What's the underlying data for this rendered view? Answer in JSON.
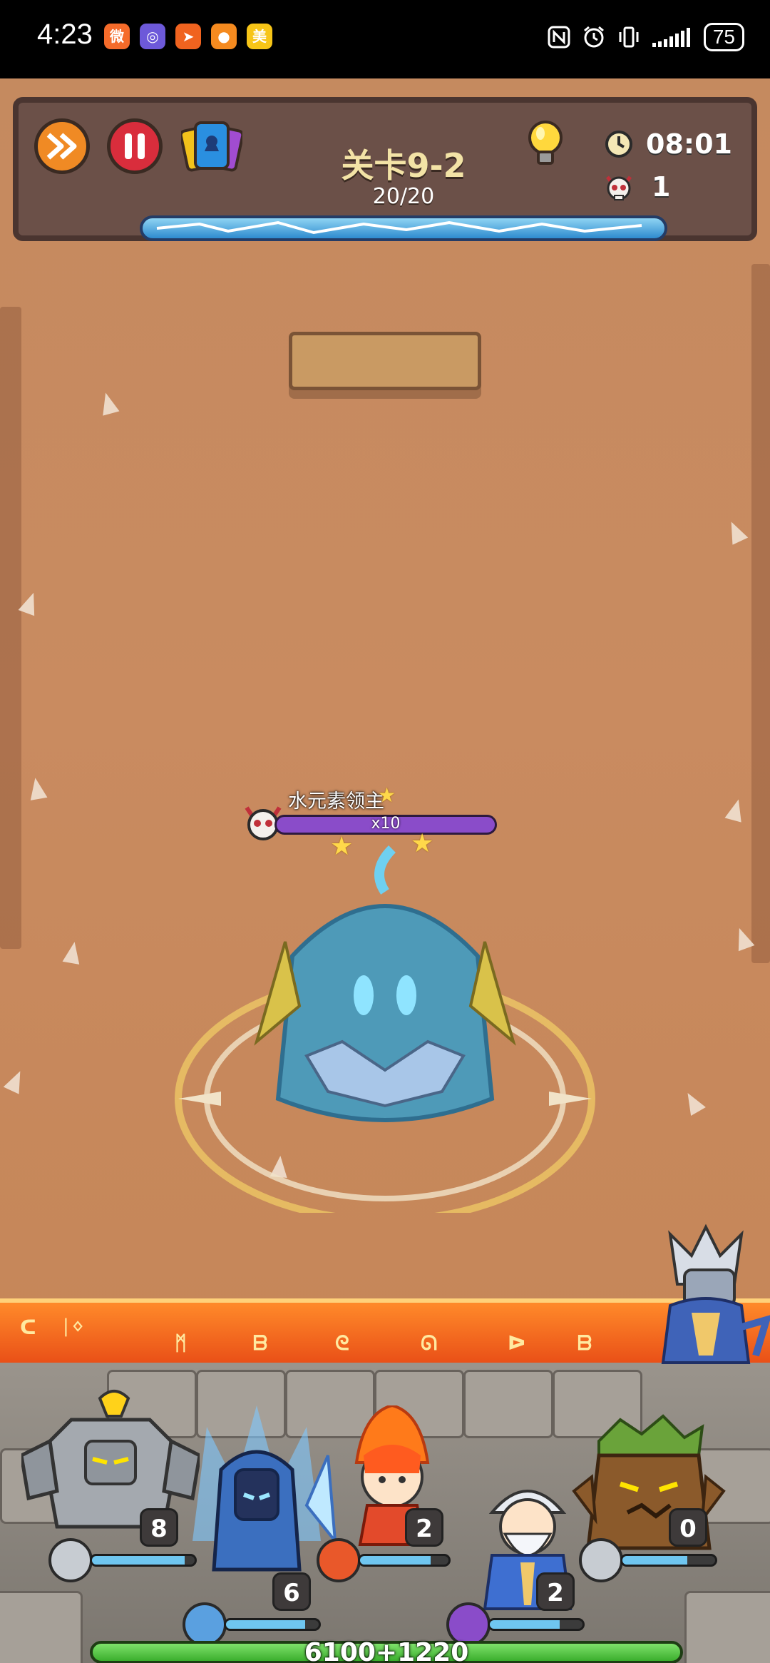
{
  "status_bar": {
    "time": "4:23",
    "battery": "75",
    "notification_apps": [
      {
        "name": "weibo",
        "glyph": "微",
        "color": "#f56b2a"
      },
      {
        "name": "app-purple",
        "glyph": "◎",
        "color": "#6d59d9"
      },
      {
        "name": "app-orange-send",
        "glyph": "➤",
        "color": "#f0631f"
      },
      {
        "name": "app-orange-chat",
        "glyph": "●",
        "color": "#f58a1f"
      },
      {
        "name": "meituan",
        "glyph": "美",
        "color": "#f7c517"
      }
    ]
  },
  "hud": {
    "level_title": "关卡9-2",
    "wave": "20/20",
    "timer": "08:01",
    "kills": "1",
    "wave_progress": 1.0
  },
  "boss": {
    "name": "水元素领主",
    "hp_multiplier": "x10",
    "stars": 3,
    "color": "#4e9ab8"
  },
  "heroes": [
    {
      "name": "rock-golem",
      "level": "8",
      "hp": 0.9,
      "color": "#9aa0a6"
    },
    {
      "name": "ice-knight",
      "level": "6",
      "hp": 0.85,
      "color": "#3b6fbf"
    },
    {
      "name": "fire-mage",
      "level": "2",
      "hp": 0.8,
      "color": "#e34a2b"
    },
    {
      "name": "old-sage",
      "level": "2",
      "hp": 0.75,
      "color": "#3e6fd1"
    },
    {
      "name": "tree-ent",
      "level": "0",
      "hp": 0.7,
      "color": "#8b5a2b"
    }
  ],
  "team": {
    "power": "6100+1220",
    "hp": 1.0
  }
}
